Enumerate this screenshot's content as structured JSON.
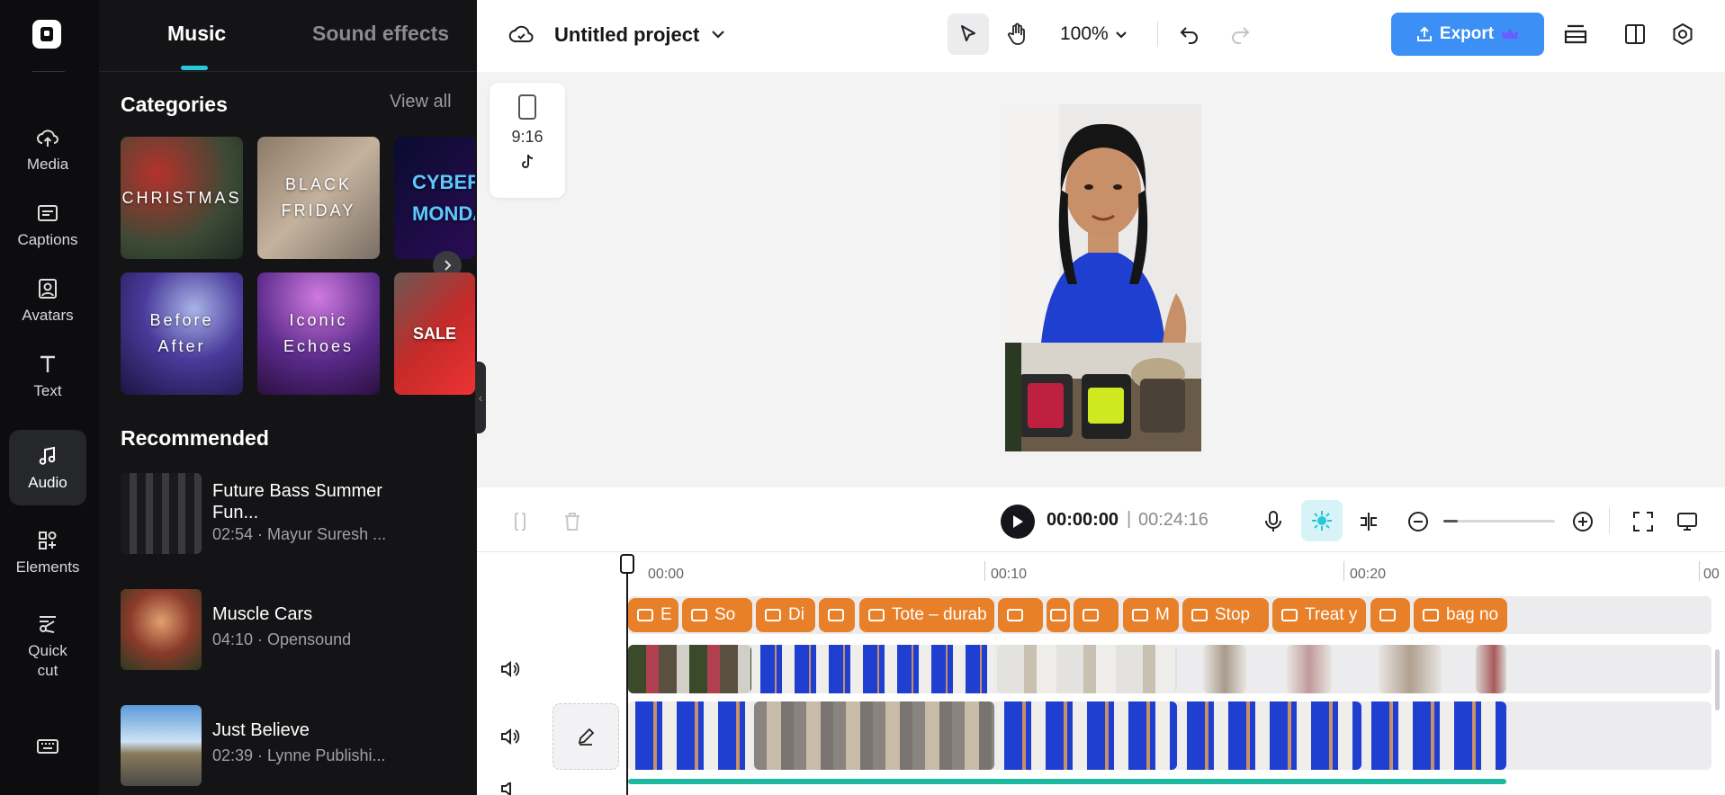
{
  "sidebar": {
    "items": [
      {
        "label": "Media",
        "icon": "cloud-upload-icon"
      },
      {
        "label": "Captions",
        "icon": "captions-icon"
      },
      {
        "label": "Avatars",
        "icon": "avatar-icon"
      },
      {
        "label": "Text",
        "icon": "text-icon"
      },
      {
        "label": "Audio",
        "icon": "music-note-icon"
      },
      {
        "label": "Elements",
        "icon": "elements-icon"
      },
      {
        "label": "Quick cut",
        "icon": "scissors-icon"
      }
    ],
    "active": "Audio"
  },
  "panel": {
    "tabs": [
      "Music",
      "Sound effects"
    ],
    "categories_title": "Categories",
    "view_all": "View all",
    "categories": [
      "CHRISTMAS",
      "BLACK FRIDAY",
      "CYBER MONDAY",
      "Before After",
      "Iconic Echoes",
      "SALE"
    ],
    "recommended_title": "Recommended",
    "tracks": [
      {
        "name": "Future Bass Summer Fun...",
        "meta": "02:54 · Mayur Suresh ..."
      },
      {
        "name": "Muscle Cars",
        "meta": "04:10 · Opensound"
      },
      {
        "name": "Just Believe",
        "meta": "02:39 · Lynne Publishi..."
      }
    ]
  },
  "topbar": {
    "project_title": "Untitled project",
    "zoom": "100%",
    "export_label": "Export"
  },
  "canvas": {
    "ratio": "9:16"
  },
  "playback": {
    "current_time": "00:00:00",
    "separator": "|",
    "total_time": "00:24:16"
  },
  "timeline": {
    "ruler": [
      "00:00",
      "00:10",
      "00:20",
      "00"
    ],
    "captions": [
      "E",
      "So",
      "Di",
      "",
      "Tote – durab",
      "",
      "",
      "",
      "M",
      "Stop",
      "Treat y",
      "",
      "bag no"
    ]
  },
  "colors": {
    "accent": "#27c8d8",
    "export": "#3b8ff5",
    "caption_chip": "#e8802a",
    "rail_bg": "#0d0d0f",
    "panel_bg": "#141416"
  }
}
